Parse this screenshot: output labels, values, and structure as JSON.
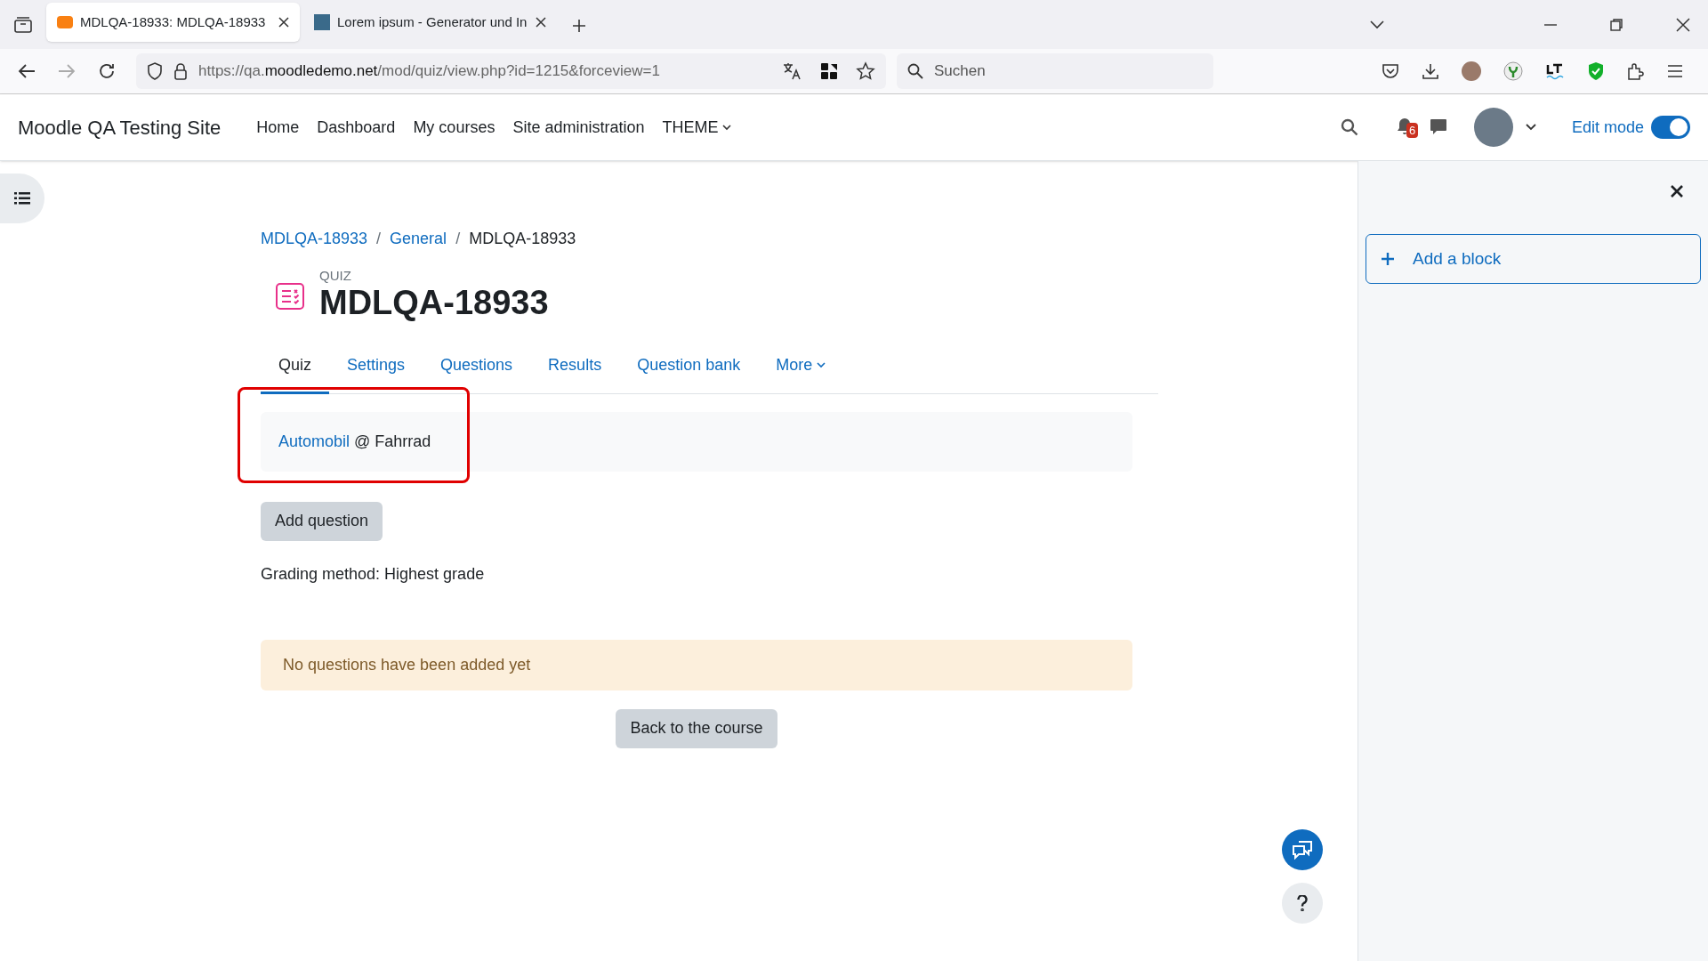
{
  "browser": {
    "tabs": [
      {
        "title": "MDLQA-18933: MDLQA-18933",
        "selected": true
      },
      {
        "title": "Lorem ipsum - Generator und In",
        "selected": false
      }
    ],
    "url": {
      "host_prefix": "https://qa.",
      "host": "moodledemo.net",
      "path": "/mod/quiz/view.php?id=1215&forceview=1"
    },
    "search": {
      "placeholder": "Suchen"
    }
  },
  "navbar": {
    "site_name": "Moodle QA Testing Site",
    "items": [
      {
        "label": "Home",
        "dropdown": false
      },
      {
        "label": "Dashboard",
        "dropdown": false
      },
      {
        "label": "My courses",
        "dropdown": false
      },
      {
        "label": "Site administration",
        "dropdown": false
      },
      {
        "label": "THEME",
        "dropdown": true
      }
    ],
    "notification_count": "6",
    "edit_mode": {
      "label": "Edit mode",
      "on": true
    }
  },
  "breadcrumb": [
    {
      "kind": "link",
      "label": "MDLQA-18933"
    },
    {
      "kind": "separator",
      "label": "/"
    },
    {
      "kind": "link",
      "label": "General"
    },
    {
      "kind": "separator",
      "label": "/"
    },
    {
      "kind": "current",
      "label": "MDLQA-18933"
    }
  ],
  "header": {
    "kind_label": "QUIZ",
    "title": "MDLQA-18933"
  },
  "tabs": [
    {
      "label": "Quiz",
      "selected": true,
      "dropdown": false
    },
    {
      "label": "Settings",
      "selected": false,
      "dropdown": false
    },
    {
      "label": "Questions",
      "selected": false,
      "dropdown": false
    },
    {
      "label": "Results",
      "selected": false,
      "dropdown": false
    },
    {
      "label": "Question bank",
      "selected": false,
      "dropdown": false
    },
    {
      "label": "More",
      "selected": false,
      "dropdown": true
    }
  ],
  "category": {
    "link": "Automobil",
    "rest": "@ Fahrrad",
    "highlighted": true
  },
  "add_question": "Add question",
  "grading": "Grading method: Highest grade",
  "alert": "No questions have been added yet",
  "back_button": "Back to the course",
  "drawer": {
    "add_block": "Add a block"
  }
}
